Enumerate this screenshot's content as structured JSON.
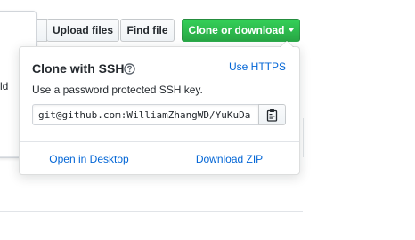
{
  "background": {
    "left_fragment_text": "ld"
  },
  "toolbar": {
    "upload_label": "Upload files",
    "find_label": "Find file",
    "clone_label": "Clone or download"
  },
  "clone_panel": {
    "title": "Clone with SSH",
    "switch_link": "Use HTTPS",
    "description": "Use a password protected SSH key.",
    "clone_url": "git@github.com:WilliamZhangWD/YuKuDa",
    "open_desktop_label": "Open in Desktop",
    "download_zip_label": "Download ZIP"
  },
  "icons": {
    "help": "question-circle-icon",
    "copy": "clipboard-icon",
    "dropdown": "caret-down-icon"
  },
  "colors": {
    "clone_button": "#28a745",
    "link": "#0366d6"
  }
}
